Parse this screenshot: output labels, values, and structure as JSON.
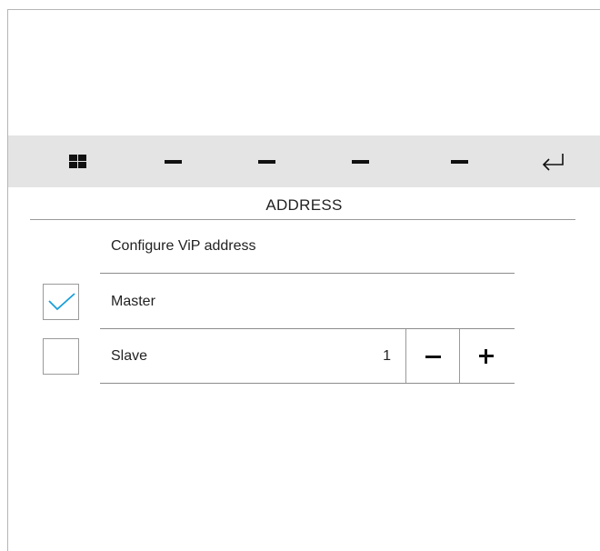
{
  "toolbar": {
    "buttons": [
      {
        "icon": "grid-icon"
      },
      {
        "icon": "dash-icon"
      },
      {
        "icon": "dash-icon"
      },
      {
        "icon": "dash-icon"
      },
      {
        "icon": "dash-icon"
      },
      {
        "icon": "back-arrow-icon"
      }
    ]
  },
  "page": {
    "title": "ADDRESS"
  },
  "section": {
    "label": "Configure ViP address"
  },
  "options": {
    "master": {
      "label": "Master",
      "checked": true
    },
    "slave": {
      "label": "Slave",
      "checked": false,
      "value": "1"
    }
  },
  "colors": {
    "toolbar_bg": "#e4e4e4",
    "check_accent": "#1a9fd9",
    "rule": "#8c8c8c"
  }
}
